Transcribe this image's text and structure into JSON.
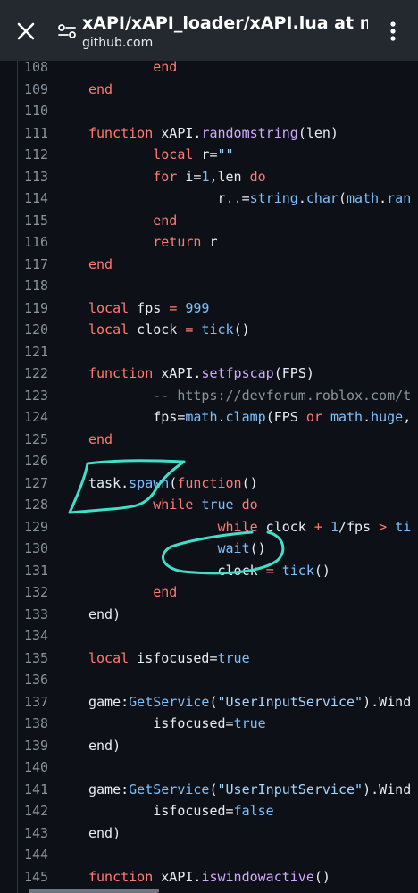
{
  "header": {
    "title": "xAPI/xAPI_loader/xAPI.lua at mai...",
    "url": "github.com",
    "close_icon": "close-icon",
    "site_settings_icon": "site-settings-icon",
    "menu_icon": "more-vertical-icon"
  },
  "colors": {
    "header_bg": "#24292f",
    "editor_bg": "#0d1117",
    "keyword": "#ff7b72",
    "function": "#d2a8ff",
    "string": "#a5d6ff",
    "number": "#79c0ff",
    "annotation": "#3ee0c8"
  },
  "code": {
    "lines": [
      {
        "n": "108",
        "t": [
          [
            "        ",
            ""
          ],
          [
            "end",
            "kw"
          ]
        ]
      },
      {
        "n": "109",
        "t": [
          [
            "end",
            "kw"
          ]
        ]
      },
      {
        "n": "110",
        "t": []
      },
      {
        "n": "111",
        "t": [
          [
            "function",
            "kw"
          ],
          [
            " xAPI.",
            ""
          ],
          [
            "randomstring",
            "fn"
          ],
          [
            "(len)",
            ""
          ]
        ]
      },
      {
        "n": "112",
        "t": [
          [
            "        ",
            ""
          ],
          [
            "local",
            "kw"
          ],
          [
            " r=",
            ""
          ],
          [
            "\"\"",
            "str"
          ]
        ]
      },
      {
        "n": "113",
        "t": [
          [
            "        ",
            ""
          ],
          [
            "for",
            "kw"
          ],
          [
            " i=",
            ""
          ],
          [
            "1",
            "num"
          ],
          [
            ",len ",
            ""
          ],
          [
            "do",
            "kw"
          ]
        ]
      },
      {
        "n": "114",
        "t": [
          [
            "                r",
            ""
          ],
          [
            "..",
            "op"
          ],
          [
            "=",
            ""
          ],
          [
            "string",
            "bi"
          ],
          [
            ".",
            ""
          ],
          [
            "char",
            "bi"
          ],
          [
            "(",
            ""
          ],
          [
            "math",
            "bi"
          ],
          [
            ".",
            ""
          ],
          [
            "ran",
            "bi"
          ]
        ]
      },
      {
        "n": "115",
        "t": [
          [
            "        ",
            ""
          ],
          [
            "end",
            "kw"
          ]
        ]
      },
      {
        "n": "116",
        "t": [
          [
            "        ",
            ""
          ],
          [
            "return",
            "kw"
          ],
          [
            " r",
            ""
          ]
        ]
      },
      {
        "n": "117",
        "t": [
          [
            "end",
            "kw"
          ]
        ]
      },
      {
        "n": "118",
        "t": []
      },
      {
        "n": "119",
        "t": [
          [
            "local",
            "kw"
          ],
          [
            " fps ",
            ""
          ],
          [
            "=",
            "op"
          ],
          [
            " ",
            ""
          ],
          [
            "999",
            "num"
          ]
        ]
      },
      {
        "n": "120",
        "t": [
          [
            "local",
            "kw"
          ],
          [
            " clock ",
            ""
          ],
          [
            "=",
            "op"
          ],
          [
            " ",
            ""
          ],
          [
            "tick",
            "bi"
          ],
          [
            "()",
            ""
          ]
        ]
      },
      {
        "n": "121",
        "t": []
      },
      {
        "n": "122",
        "t": [
          [
            "function",
            "kw"
          ],
          [
            " xAPI.",
            ""
          ],
          [
            "setfpscap",
            "fn"
          ],
          [
            "(FPS)",
            ""
          ]
        ]
      },
      {
        "n": "123",
        "t": [
          [
            "        ",
            ""
          ],
          [
            "-- https://devforum.roblox.com/t",
            "cm"
          ]
        ]
      },
      {
        "n": "124",
        "t": [
          [
            "        fps=",
            ""
          ],
          [
            "math",
            "bi"
          ],
          [
            ".",
            ""
          ],
          [
            "clamp",
            "bi"
          ],
          [
            "(FPS ",
            ""
          ],
          [
            "or",
            "kw"
          ],
          [
            " ",
            ""
          ],
          [
            "math",
            "bi"
          ],
          [
            ".",
            ""
          ],
          [
            "huge",
            "bi"
          ],
          [
            ",",
            ""
          ]
        ]
      },
      {
        "n": "125",
        "t": [
          [
            "end",
            "kw"
          ]
        ]
      },
      {
        "n": "126",
        "t": []
      },
      {
        "n": "127",
        "t": [
          [
            "task.",
            ""
          ],
          [
            "spawn",
            "bi"
          ],
          [
            "(",
            ""
          ],
          [
            "function",
            "kw"
          ],
          [
            "()",
            ""
          ]
        ]
      },
      {
        "n": "128",
        "t": [
          [
            "        ",
            ""
          ],
          [
            "while",
            "kw"
          ],
          [
            " ",
            ""
          ],
          [
            "true",
            "num"
          ],
          [
            " ",
            ""
          ],
          [
            "do",
            "kw"
          ]
        ]
      },
      {
        "n": "129",
        "t": [
          [
            "                ",
            ""
          ],
          [
            "while",
            "kw"
          ],
          [
            " clock ",
            ""
          ],
          [
            "+",
            "op"
          ],
          [
            " ",
            ""
          ],
          [
            "1",
            "num"
          ],
          [
            "/fps ",
            ""
          ],
          [
            ">",
            "op"
          ],
          [
            " ",
            ""
          ],
          [
            "ti",
            "bi"
          ]
        ]
      },
      {
        "n": "130",
        "t": [
          [
            "                ",
            ""
          ],
          [
            "wait",
            "bi"
          ],
          [
            "()",
            ""
          ]
        ]
      },
      {
        "n": "131",
        "t": [
          [
            "                clock ",
            ""
          ],
          [
            "=",
            "op"
          ],
          [
            " ",
            ""
          ],
          [
            "tick",
            "bi"
          ],
          [
            "()",
            ""
          ]
        ]
      },
      {
        "n": "132",
        "t": [
          [
            "        ",
            ""
          ],
          [
            "end",
            "kw"
          ]
        ]
      },
      {
        "n": "133",
        "t": [
          [
            "end)",
            ""
          ]
        ]
      },
      {
        "n": "134",
        "t": []
      },
      {
        "n": "135",
        "t": [
          [
            "local",
            "kw"
          ],
          [
            " isfocused=",
            ""
          ],
          [
            "true",
            "num"
          ]
        ]
      },
      {
        "n": "136",
        "t": []
      },
      {
        "n": "137",
        "t": [
          [
            "game:",
            ""
          ],
          [
            "GetService",
            "bi"
          ],
          [
            "(",
            ""
          ],
          [
            "\"UserInputService\"",
            "str"
          ],
          [
            ").Wind",
            ""
          ]
        ]
      },
      {
        "n": "138",
        "t": [
          [
            "        isfocused=",
            ""
          ],
          [
            "true",
            "num"
          ]
        ]
      },
      {
        "n": "139",
        "t": [
          [
            "end)",
            ""
          ]
        ]
      },
      {
        "n": "140",
        "t": []
      },
      {
        "n": "141",
        "t": [
          [
            "game:",
            ""
          ],
          [
            "GetService",
            "bi"
          ],
          [
            "(",
            ""
          ],
          [
            "\"UserInputService\"",
            "str"
          ],
          [
            ").Wind",
            ""
          ]
        ]
      },
      {
        "n": "142",
        "t": [
          [
            "        isfocused=",
            ""
          ],
          [
            "false",
            "num"
          ]
        ]
      },
      {
        "n": "143",
        "t": [
          [
            "end)",
            ""
          ]
        ]
      },
      {
        "n": "144",
        "t": []
      },
      {
        "n": "145",
        "t": [
          [
            "function",
            "kw"
          ],
          [
            " xAPI.",
            ""
          ],
          [
            "iswindowactive",
            "fn"
          ],
          [
            "()",
            ""
          ]
        ]
      }
    ]
  }
}
